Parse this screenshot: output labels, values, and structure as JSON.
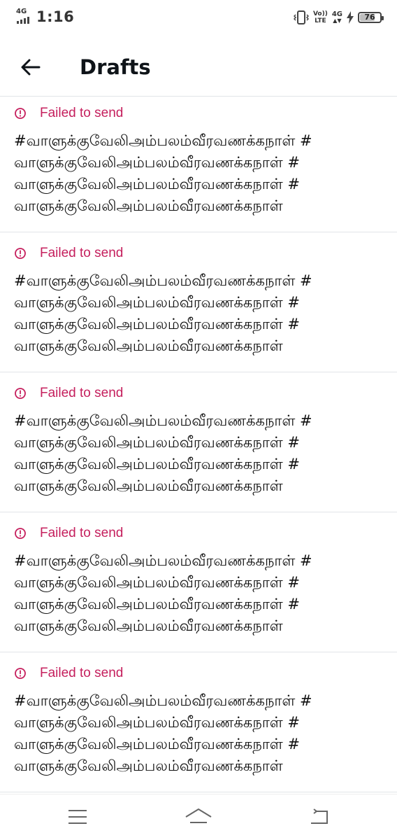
{
  "status_bar": {
    "network_left": "4G",
    "time": "1:16",
    "volte_top": "Vo))",
    "volte_bottom": "LTE",
    "network_right": "4G",
    "battery_level": "76",
    "battery_fraction": 0.76,
    "icons": [
      "signal-icon",
      "vibrate-icon",
      "volte-icon",
      "charging-bolt-icon",
      "battery-icon"
    ]
  },
  "header": {
    "back_icon": "back-arrow-icon",
    "title": "Drafts"
  },
  "drafts": [
    {
      "status": "Failed to send",
      "status_icon": "alert-circle-icon",
      "text": "#வாளுக்குவேலிஅம்பலம்வீரவணக்கநாள் #வாளுக்குவேலிஅம்பலம்வீரவணக்கநாள் #வாளுக்குவேலிஅம்பலம்வீரவணக்கநாள் #வாளுக்குவேலிஅம்பலம்வீரவணக்கநாள்"
    },
    {
      "status": "Failed to send",
      "status_icon": "alert-circle-icon",
      "text": "#வாளுக்குவேலிஅம்பலம்வீரவணக்கநாள் #வாளுக்குவேலிஅம்பலம்வீரவணக்கநாள் #வாளுக்குவேலிஅம்பலம்வீரவணக்கநாள் #வாளுக்குவேலிஅம்பலம்வீரவணக்கநாள்"
    },
    {
      "status": "Failed to send",
      "status_icon": "alert-circle-icon",
      "text": "#வாளுக்குவேலிஅம்பலம்வீரவணக்கநாள் #வாளுக்குவேலிஅம்பலம்வீரவணக்கநாள் #வாளுக்குவேலிஅம்பலம்வீரவணக்கநாள் #வாளுக்குவேலிஅம்பலம்வீரவணக்கநாள்"
    },
    {
      "status": "Failed to send",
      "status_icon": "alert-circle-icon",
      "text": "#வாளுக்குவேலிஅம்பலம்வீரவணக்கநாள் #வாளுக்குவேலிஅம்பலம்வீரவணக்கநாள் #வாளுக்குவேலிஅம்பலம்வீரவணக்கநாள் #வாளுக்குவேலிஅம்பலம்வீரவணக்கநாள்"
    },
    {
      "status": "Failed to send",
      "status_icon": "alert-circle-icon",
      "text": "#வாளுக்குவேலிஅம்பலம்வீரவணக்கநாள் #வாளுக்குவேலிஅம்பலம்வீரவணக்கநாள் #வாளுக்குவேலிஅம்பலம்வீரவணக்கநாள் #வாளுக்குவேலிஅம்பலம்வீரவணக்கநாள்"
    }
  ],
  "nav_bar": {
    "icons": [
      "menu-icon",
      "home-icon",
      "back-icon"
    ]
  },
  "colors": {
    "error": "#c51f5d",
    "text": "#111111",
    "divider": "#e1e4e8"
  }
}
